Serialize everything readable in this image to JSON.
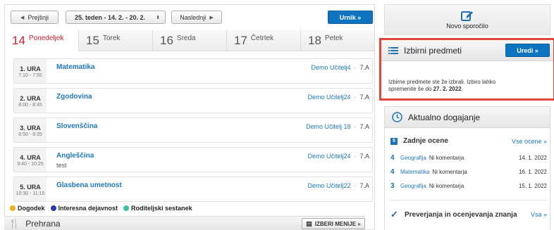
{
  "nav": {
    "prev_label": "Prejšnji",
    "week_label": "25. teden - 14. 2. - 20. 2.",
    "next_label": "Naslednji",
    "urnik_label": "Urnik »"
  },
  "days": [
    {
      "num": "14",
      "name": "Ponedeljek",
      "active": true
    },
    {
      "num": "15",
      "name": "Torek",
      "active": false
    },
    {
      "num": "16",
      "name": "Sreda",
      "active": false
    },
    {
      "num": "17",
      "name": "Četrtek",
      "active": false
    },
    {
      "num": "18",
      "name": "Petek",
      "active": false
    }
  ],
  "lessons": [
    {
      "period": "1. URA",
      "time": "7:10 - 7:55",
      "subject": "Matematika",
      "note": "",
      "teacher": "Demo Učitelj4",
      "cls": "7.A"
    },
    {
      "period": "2. URA",
      "time": "8:00 - 8:45",
      "subject": "Zgodovina",
      "note": "",
      "teacher": "Demo Učitelj24",
      "cls": "7.A"
    },
    {
      "period": "3. URA",
      "time": "8:50 - 9:35",
      "subject": "Slovenščina",
      "note": "",
      "teacher": "Demo Učitelj 18",
      "cls": "7.A"
    },
    {
      "period": "4. URA",
      "time": "9:40 - 10:25",
      "subject": "Angleščina",
      "note": "test",
      "teacher": "Demo Učitelj24",
      "cls": "7.A"
    },
    {
      "period": "5. URA",
      "time": "10:30 - 11:15",
      "subject": "Glasbena umetnost",
      "note": "",
      "teacher": "Demo Učitelj22",
      "cls": "7.A"
    }
  ],
  "legend": [
    {
      "label": "Dogodek",
      "color": "#f2b01e",
      "icon": ""
    },
    {
      "label": "Interesna dejavnost",
      "color": "#2b3aa8",
      "icon": "ID"
    },
    {
      "label": "Roditeljski sestanek",
      "color": "#3fc1a5",
      "icon": "R"
    }
  ],
  "prehrana": {
    "title": "Prehrana",
    "button": "IZBERI MENIJE »"
  },
  "novo": {
    "label": "Novo sporočilo"
  },
  "izbirni": {
    "title": "Izbirni predmeti",
    "text_before": "Izbirne predmete ste že izbrali. Izbiro lahko spremenite še do ",
    "date": "27. 2. 2022",
    "text_after": ".",
    "button": "Uredi »"
  },
  "aktualno": {
    "title": "Aktualno dogajanje",
    "grades_title": "Zadnje ocene",
    "grades_link": "Vse ocene »",
    "grades": [
      {
        "grade": "4",
        "subject": "Geografija",
        "comment": "Ni komentarja",
        "date": "14. 1. 2022"
      },
      {
        "grade": "4",
        "subject": "Matematika",
        "comment": "Ni komentarja",
        "date": "16. 1. 2022"
      },
      {
        "grade": "3",
        "subject": "Geografija",
        "comment": "Ni komentarja",
        "date": "15. 1. 2022"
      }
    ],
    "tests_title": "Preverjanja in ocenjevanja znanja",
    "tests_link": "Vsa »"
  },
  "colors": {
    "accent": "#0e74c0",
    "highlight_border": "#e2453c",
    "active_day": "#d0202a",
    "link": "#1f78c1"
  }
}
